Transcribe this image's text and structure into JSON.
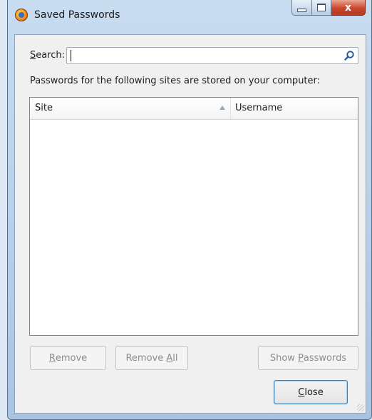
{
  "window": {
    "title": "Saved Passwords",
    "close_glyph": "x"
  },
  "search": {
    "label_accesskey": "S",
    "label_rest": "earch:",
    "value": "",
    "icon": "search-icon"
  },
  "description": "Passwords for the following sites are stored on your computer:",
  "tree": {
    "columns": [
      {
        "label": "Site",
        "sort": "ascending"
      },
      {
        "label": "Username"
      }
    ],
    "rows": []
  },
  "buttons": {
    "remove": {
      "accesskey": "R",
      "rest": "emove"
    },
    "remove_all": {
      "before": "Remove ",
      "accesskey": "A",
      "after": "ll"
    },
    "show_passwords": {
      "before": "Show ",
      "accesskey": "P",
      "after": "asswords"
    },
    "close": {
      "accesskey": "C",
      "rest": "lose"
    }
  },
  "colors": {
    "close_button": "#c9462c",
    "frame": "#a9c4e2"
  }
}
